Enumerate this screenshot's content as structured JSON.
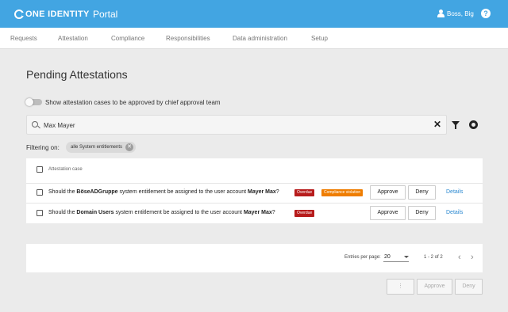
{
  "brand": {
    "logo_text": "ONE IDENTITY",
    "app_name": "Portal",
    "accent": "#42a5e2"
  },
  "header": {
    "user_name": "Boss, Big",
    "help_label": "?"
  },
  "nav": {
    "items": [
      "Requests",
      "Attestation",
      "Compliance",
      "Responsibilities",
      "Data administration",
      "Setup"
    ]
  },
  "page": {
    "title": "Pending Attestations"
  },
  "toggle": {
    "label": "Show attestation cases to be approved by chief approval team",
    "on": false
  },
  "search": {
    "value": "Max Mayer",
    "clear_label": "✕"
  },
  "filter": {
    "label": "Filtering on:",
    "chip": "alle System entitlements"
  },
  "table": {
    "header": "Attestation case",
    "rows": [
      {
        "pre": "Should the ",
        "entitlement": "BöseADGruppe",
        "mid": " system entitlement be assigned to the user account ",
        "account": "Mayer Max",
        "post": "?",
        "badges": [
          "Overdue",
          "Compliance violation"
        ],
        "approve": "Approve",
        "deny": "Deny",
        "details": "Details"
      },
      {
        "pre": "Should the ",
        "entitlement": "Domain Users",
        "mid": " system entitlement be assigned to the user account ",
        "account": "Mayer Max",
        "post": "?",
        "badges": [
          "Overdue"
        ],
        "approve": "Approve",
        "deny": "Deny",
        "details": "Details"
      }
    ]
  },
  "pager": {
    "label": "Entries per page:",
    "per_page": "20",
    "range": "1 - 2 of 2"
  },
  "footer": {
    "more_label": "⋮",
    "approve_label": "Approve",
    "deny_label": "Deny"
  }
}
